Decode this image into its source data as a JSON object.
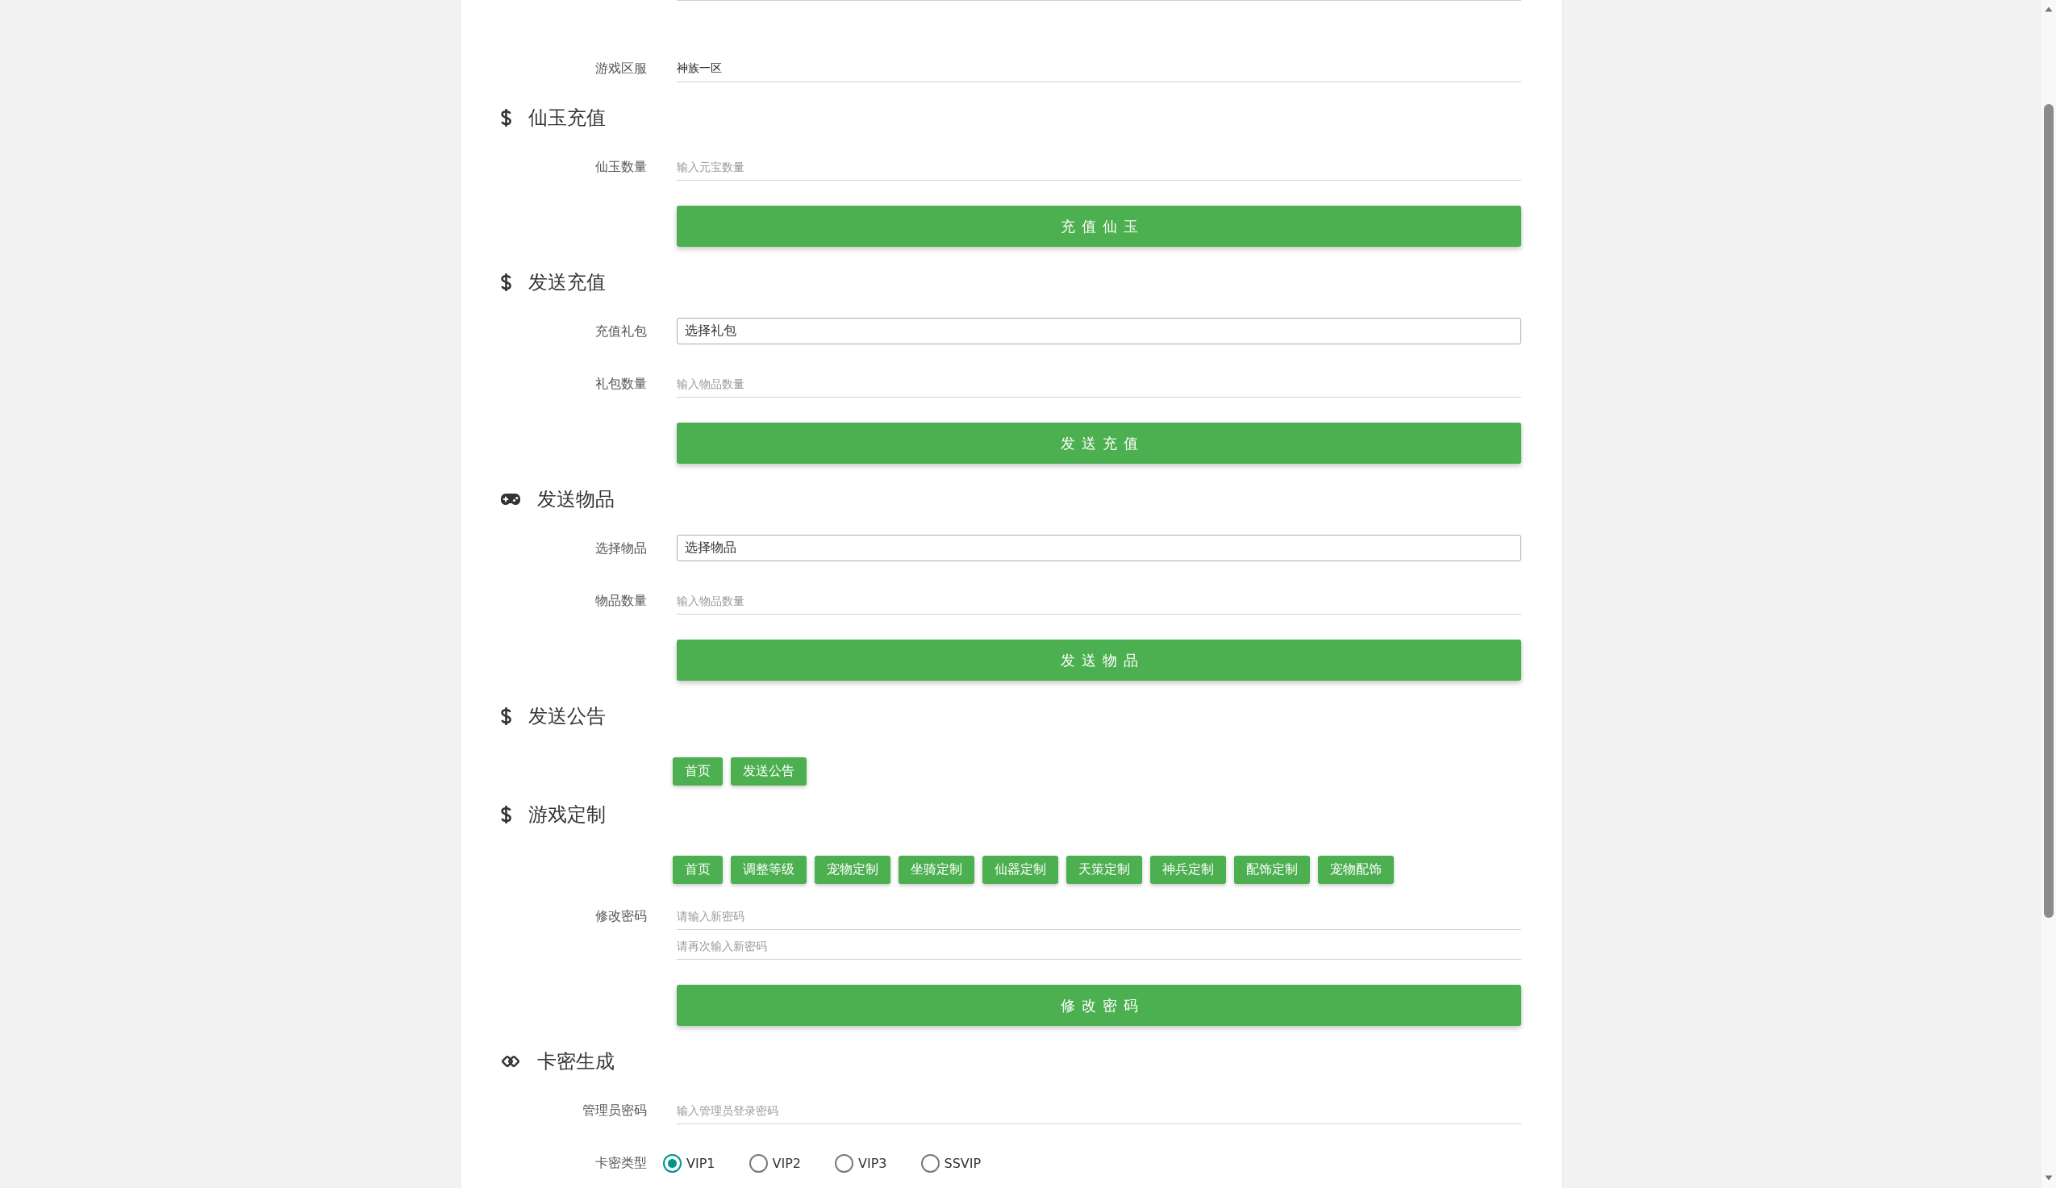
{
  "server": {
    "kind": "input",
    "label": "游戏区服",
    "value": "神族一区"
  },
  "sections": [
    {
      "kind": "dollar",
      "title": "仙玉充值",
      "items": [
        {
          "kind": "input",
          "label": "仙玉数量",
          "placeholder": "输入元宝数量"
        },
        {
          "kind": "button",
          "label": "充值仙玉"
        }
      ]
    },
    {
      "kind": "dollar",
      "title": "发送充值",
      "items": [
        {
          "kind": "select",
          "label": "充值礼包",
          "value": "选择礼包"
        },
        {
          "kind": "input",
          "label": "礼包数量",
          "placeholder": "输入物品数量"
        },
        {
          "kind": "button",
          "label": "发送充值"
        }
      ]
    },
    {
      "kind": "gamepad",
      "title": "发送物品",
      "items": [
        {
          "kind": "select",
          "label": "选择物品",
          "value": "选择物品"
        },
        {
          "kind": "input",
          "label": "物品数量",
          "placeholder": "输入物品数量"
        },
        {
          "kind": "button",
          "label": "发送物品"
        }
      ]
    },
    {
      "kind": "dollar",
      "title": "发送公告",
      "items": [
        {
          "kind": "button-row",
          "buttons": [
            "首页",
            "发送公告"
          ]
        }
      ]
    },
    {
      "kind": "dollar",
      "title": "游戏定制",
      "items": [
        {
          "kind": "button-row",
          "buttons": [
            "首页",
            "调整等级",
            "宠物定制",
            "坐骑定制",
            "仙器定制",
            "天策定制",
            "神兵定制",
            "配饰定制",
            "宠物配饰"
          ]
        },
        {
          "kind": "input-group",
          "label": "修改密码",
          "placeholders": [
            "请输入新密码",
            "请再次输入新密码"
          ]
        },
        {
          "kind": "button",
          "label": "修改密码"
        }
      ]
    },
    {
      "kind": "link",
      "title": "卡密生成",
      "items": [
        {
          "kind": "input",
          "label": "管理员密码",
          "placeholder": "输入管理员登录密码"
        },
        {
          "kind": "radio-group",
          "label": "卡密类型",
          "options": [
            {
              "label": "VIP1",
              "selected": true
            },
            {
              "label": "VIP2",
              "selected": false
            },
            {
              "label": "VIP3",
              "selected": false
            },
            {
              "label": "SSVIP",
              "selected": false
            }
          ]
        }
      ]
    }
  ]
}
